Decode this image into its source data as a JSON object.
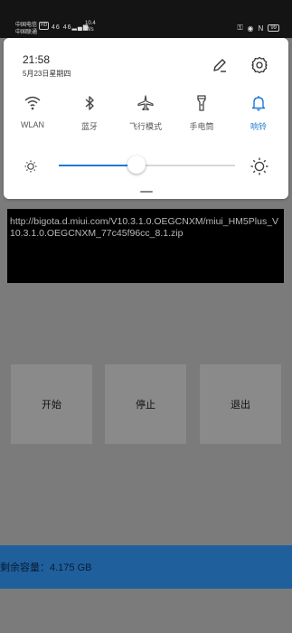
{
  "status_bar": {
    "carrier1": "中国电信",
    "carrier2": "中国联通",
    "hd_badge": "HD",
    "signal_text": "46 46",
    "speed_value": "10.4",
    "speed_unit": "M/s",
    "battery": "99"
  },
  "shade": {
    "time": "21:58",
    "date": "5月23日星期四",
    "tiles": [
      {
        "label": "WLAN",
        "icon": "wifi-icon",
        "active": false
      },
      {
        "label": "蓝牙",
        "icon": "bluetooth-icon",
        "active": false
      },
      {
        "label": "飞行模式",
        "icon": "airplane-icon",
        "active": false
      },
      {
        "label": "手电筒",
        "icon": "flashlight-icon",
        "active": false
      },
      {
        "label": "响铃",
        "icon": "bell-icon",
        "active": true
      }
    ],
    "brightness": 0.44,
    "accent": "#1f7ad6"
  },
  "app": {
    "url": "http://bigota.d.miui.com/V10.3.1.0.OEGCNXM/miui_HM5Plus_V10.3.1.0.OEGCNXM_77c45f96cc_8.1.zip",
    "buttons": {
      "start": "开始",
      "stop": "停止",
      "exit": "退出"
    },
    "storage_text": "剩余容量：4.175 GB"
  }
}
